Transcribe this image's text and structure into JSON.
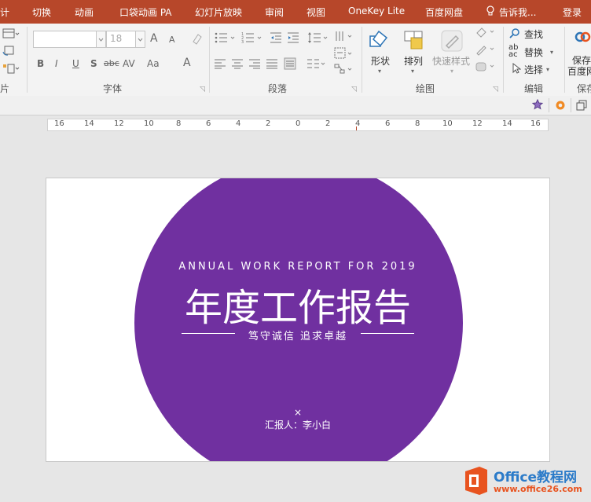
{
  "colors": {
    "titlebar": "#b7472a",
    "accent": "#7030a0",
    "logo_orange": "#e8531f"
  },
  "menubar": {
    "tab_design_partial": "计",
    "tab_transitions": "切换",
    "tab_animations": "动画",
    "tab_pocket": "口袋动画 PA",
    "tab_slideshow": "幻灯片放映",
    "tab_review": "审阅",
    "tab_view": "视图",
    "tab_onekey": "OneKey Lite",
    "tab_baidu": "百度网盘",
    "tell_me": "告诉我...",
    "login": "登录"
  },
  "ribbon": {
    "font_size": "18",
    "group_slides_partial": "片",
    "group_font": "字体",
    "group_paragraph": "段落",
    "group_drawing": "绘图",
    "group_editing": "编辑",
    "group_save_partial": "保存",
    "btn_shapes": "形状",
    "btn_arrange": "排列",
    "btn_quick_styles": "快速样式",
    "btn_find": "查找",
    "btn_replace": "替换",
    "btn_select": "选择",
    "btn_save_line1": "保存",
    "btn_save_line2": "百度网",
    "font_bold": "B",
    "font_italic": "I",
    "font_underline": "U",
    "font_shadow": "S",
    "font_strike": "abc",
    "font_spacing": "AV",
    "font_case": "Aa",
    "font_color": "A",
    "grow_font": "A",
    "shrink_font": "A",
    "ab_letters": "ab",
    "ac_letters": "ac"
  },
  "ruler": {
    "ticks": [
      "16",
      "14",
      "12",
      "10",
      "8",
      "6",
      "4",
      "2",
      "0",
      "2",
      "4",
      "6",
      "8",
      "10",
      "12",
      "14",
      "16"
    ]
  },
  "slide": {
    "subtitle": "ANNUAL WORK REPORT FOR 2019",
    "title": "年度工作报告",
    "slogan": "笃守诚信 追求卓越",
    "x_mark": "×",
    "reporter": "汇报人：李小白"
  },
  "watermark": {
    "brand": "Office教程网",
    "url": "www.office26.com"
  }
}
